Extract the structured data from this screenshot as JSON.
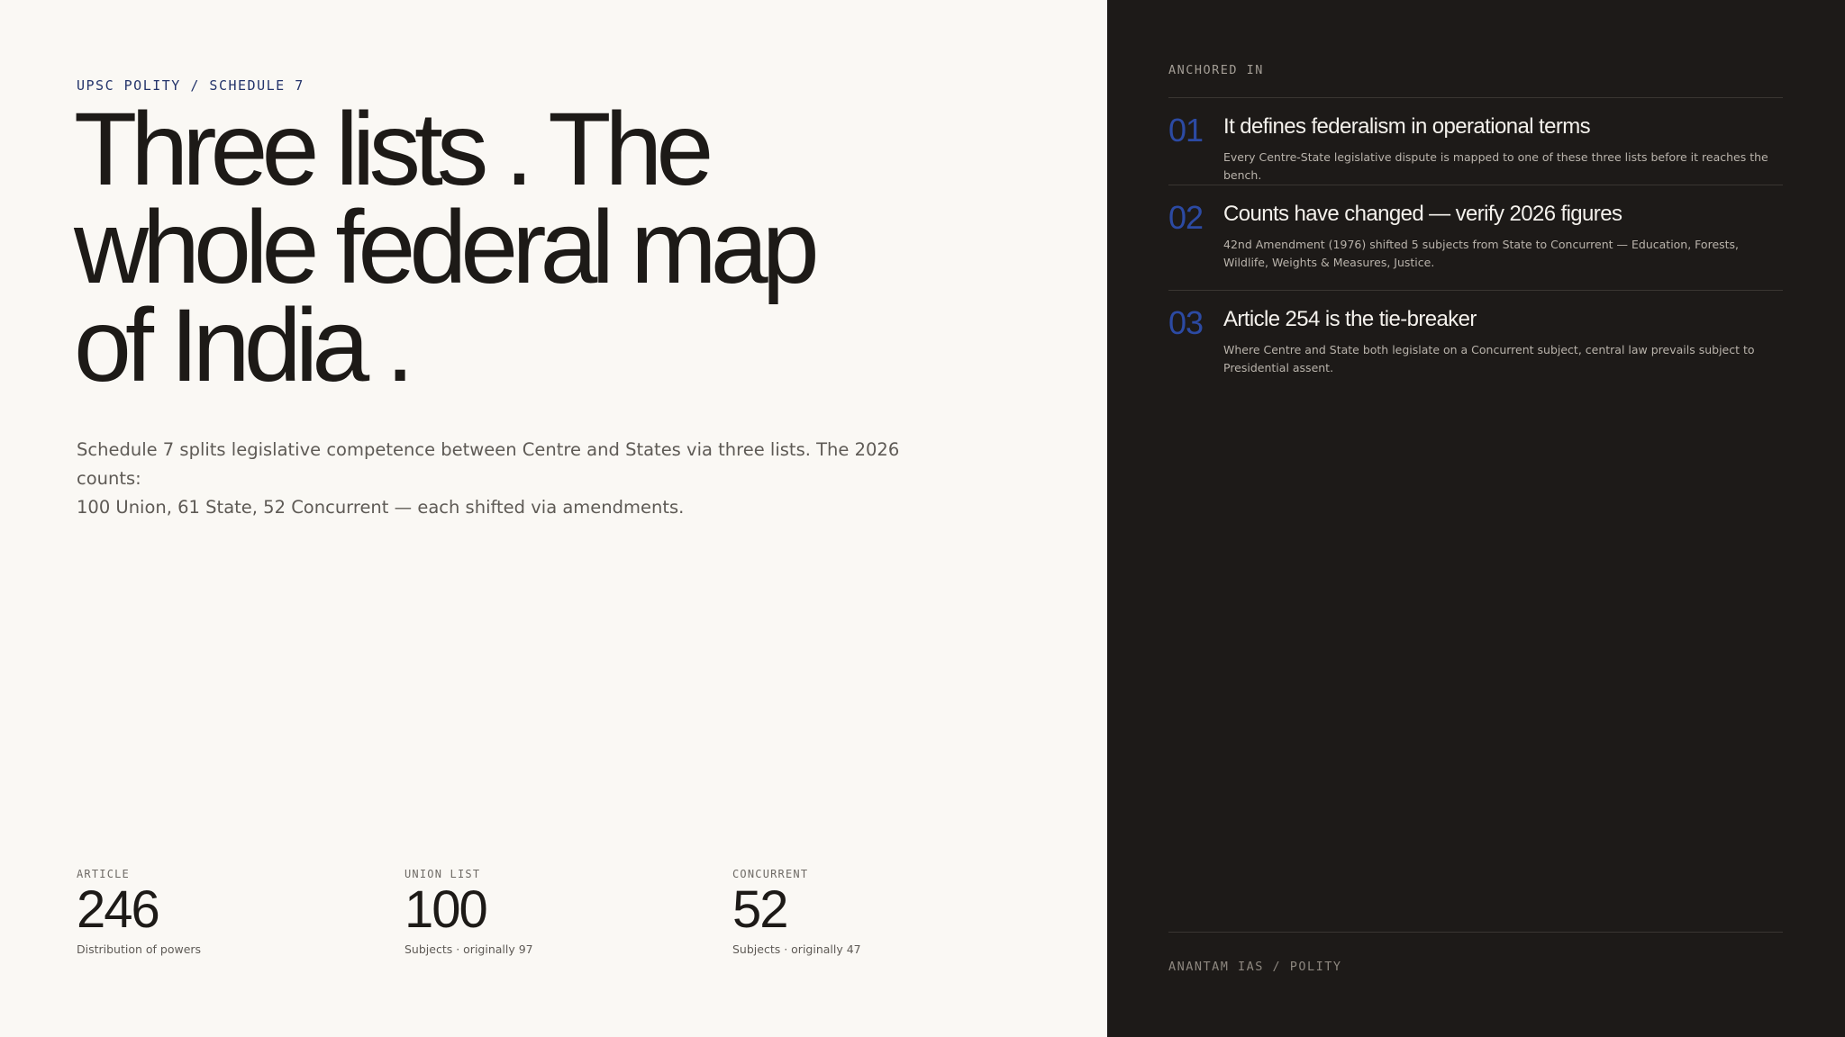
{
  "eyebrow": "UPSC POLITY / SCHEDULE 7",
  "headline": {
    "line1": "Three lists .  The",
    "line2": "whole federal map",
    "line3": "of India ."
  },
  "lede": {
    "line1": "Schedule 7 splits legislative competence between Centre and States via three lists. The 2026 counts:",
    "line2": "100 Union, 61 State, 52 Concurrent — each shifted via amendments."
  },
  "stats": [
    {
      "label": "ARTICLE",
      "value": "246",
      "caption": "Distribution of powers"
    },
    {
      "label": "UNION LIST",
      "value": "100",
      "caption": "Subjects · originally 97"
    },
    {
      "label": "CONCURRENT",
      "value": "52",
      "caption": "Subjects · originally 47"
    }
  ],
  "sidebar": {
    "label": "ANCHORED IN",
    "items": [
      {
        "num": "01",
        "title": "It defines federalism in operational terms",
        "desc": "Every Centre-State legislative dispute is mapped to one of these three lists before it reaches the bench."
      },
      {
        "num": "02",
        "title": "Counts have changed — verify 2026 figures",
        "desc": "42nd Amendment (1976) shifted 5 subjects from State to Concurrent — Education, Forests, Wildlife, Weights & Measures, Justice."
      },
      {
        "num": "03",
        "title": "Article 254 is the tie-breaker",
        "desc": "Where Centre and State both legislate on a Concurrent subject, central law prevails subject to Presidential assent."
      }
    ],
    "footer": "ANANTAM IAS / POLITY"
  },
  "colors": {
    "background_left": "#faf8f4",
    "background_right": "#1d1a18",
    "accent": "#2c4aa3",
    "eyebrow": "#24346b"
  }
}
